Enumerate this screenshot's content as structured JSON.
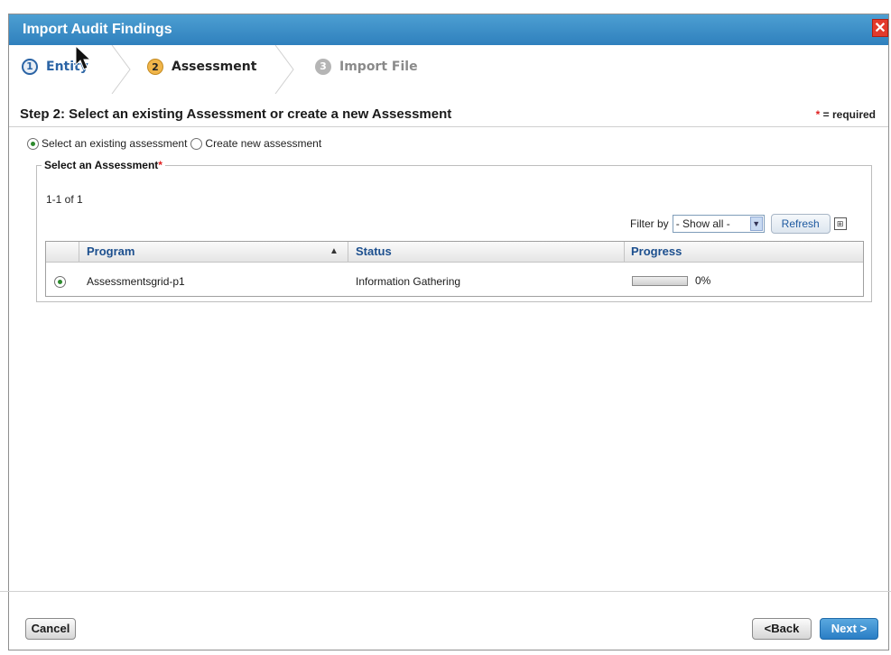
{
  "dialog": {
    "title": "Import Audit Findings",
    "close_label": "✕"
  },
  "wizard": {
    "steps": [
      {
        "number": "1",
        "label": "Entity",
        "state": "done"
      },
      {
        "number": "2",
        "label": "Assessment",
        "state": "active"
      },
      {
        "number": "3",
        "label": "Import File",
        "state": "future"
      }
    ]
  },
  "content": {
    "title": "Step 2: Select an existing Assessment or create a new Assessment",
    "required_star": "*",
    "required_note": " = required",
    "options": {
      "existing_label": "Select an existing assessment",
      "existing_selected": true,
      "new_label": "Create new assessment"
    }
  },
  "assessment_panel": {
    "legend": "Select an Assessment",
    "required_star": "*",
    "count": "1-1 of 1",
    "filter_label": "Filter by",
    "filter_value": "- Show all -",
    "refresh_label": "Refresh",
    "columns": [
      "Program",
      "Status",
      "Progress"
    ],
    "rows": [
      {
        "selected": true,
        "program": "Assessmentsgrid-p1",
        "status": "Information Gathering",
        "progress_pct": 0,
        "progress_text": "0%"
      }
    ]
  },
  "footer": {
    "cancel_label": "Cancel",
    "back_label": "<Back",
    "next_label": "Next >"
  },
  "colors": {
    "titlebar": "#3a8cc8",
    "active_step": "#f0b54a",
    "link_blue": "#2b64a5",
    "next_button": "#2a7ec5",
    "required_star": "#e02020"
  }
}
